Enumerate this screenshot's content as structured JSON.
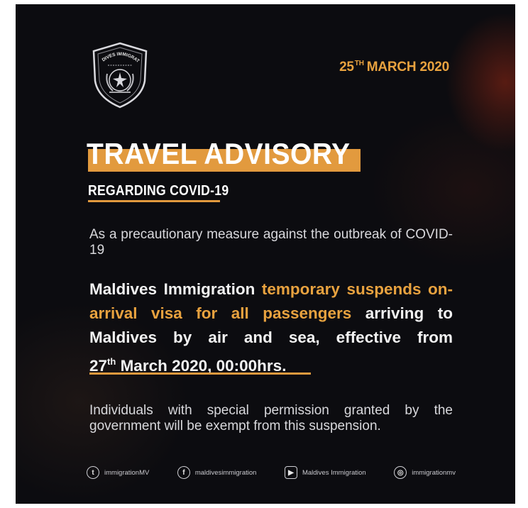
{
  "logo": {
    "name": "maldives-immigration-emblem",
    "text": "MALDIVES IMMIGRATION"
  },
  "date": {
    "day": "25",
    "suffix": "TH",
    "rest": "MARCH 2020"
  },
  "title": "TRAVEL ADVISORY",
  "subtitle": "REGARDING COVID-19",
  "intro": "As a precautionary measure against the outbreak of COVID-19",
  "main": {
    "part1": "Maldives Immigration ",
    "highlight": "temporary suspends on-arrival visa for all passengers",
    "part2": " arriving to Maldives by air and sea, effective from",
    "date_day": "27",
    "date_suffix": "th",
    "date_rest": " March 2020, 00:00hrs."
  },
  "note": "Individuals with special permission granted by the government will be exempt from this suspension.",
  "socials": [
    {
      "icon": "twitter-icon",
      "glyph": "t",
      "label": "immigrationMV"
    },
    {
      "icon": "facebook-icon",
      "glyph": "f",
      "label": "maldivesimmigration"
    },
    {
      "icon": "youtube-icon",
      "glyph": "▶",
      "label": "Maldives Immigration"
    },
    {
      "icon": "instagram-icon",
      "glyph": "◎",
      "label": "immigrationmv"
    }
  ],
  "colors": {
    "accent": "#e29a3e",
    "background": "#0c0c10",
    "text": "#ffffff"
  }
}
